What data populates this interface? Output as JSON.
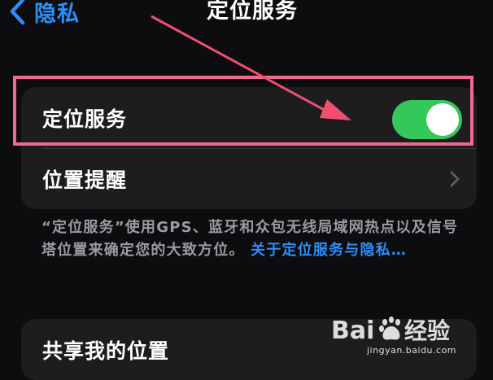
{
  "nav": {
    "back_label": "隐私",
    "title": "定位服务"
  },
  "settings": {
    "location_services": {
      "label": "定位服务",
      "enabled": true
    },
    "location_alerts": {
      "label": "位置提醒"
    },
    "share_my_location": {
      "label": "共享我的位置"
    }
  },
  "footer": {
    "text": "“定位服务”使用GPS、蓝牙和众包无线局域网热点以及信号塔位置来确定您的大致方位。",
    "link": "关于定位服务与隐私…"
  },
  "annotation": {
    "highlight_color": "#f06a8e"
  },
  "watermark": {
    "brand": "Baidu经验",
    "url": "jingyan.baidu.com"
  },
  "icons": [
    "chevron-left-icon",
    "chevron-right-icon",
    "toggle-switch"
  ],
  "colors": {
    "accent": "#2f8ef5",
    "toggle_on": "#34c759",
    "background": "#0d0d0f",
    "cell": "#1d1d20"
  }
}
